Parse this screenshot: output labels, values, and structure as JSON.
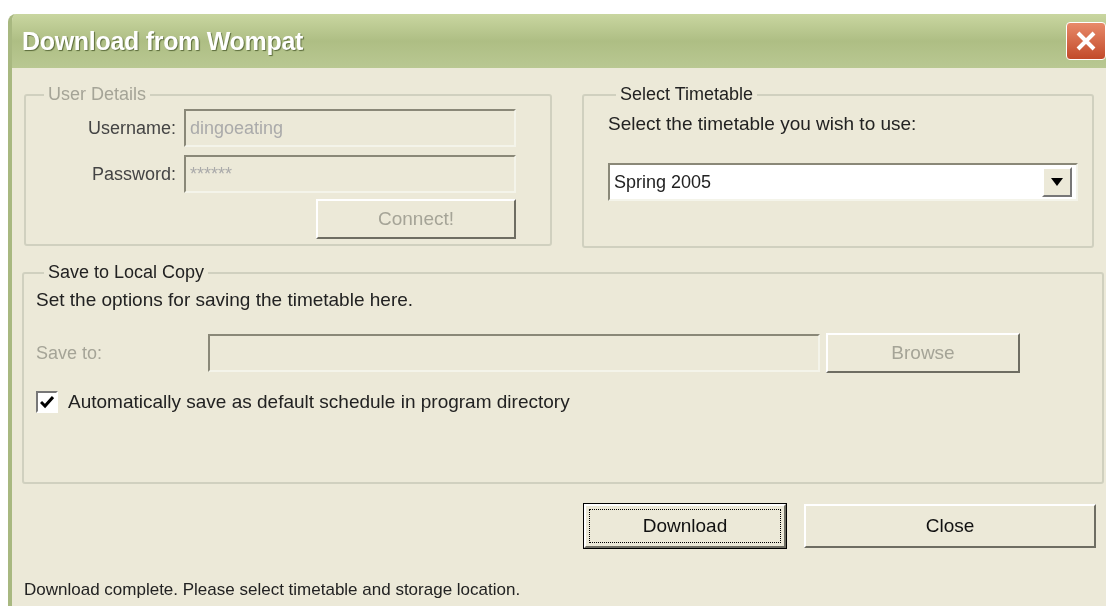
{
  "window": {
    "title": "Download from Wompat"
  },
  "user_details": {
    "legend": "User Details",
    "disabled": true,
    "fields": [
      {
        "label": "Username:",
        "value": "dingoeating"
      },
      {
        "label": "Password:",
        "value": "******"
      }
    ],
    "connect_button": {
      "label": "Connect!",
      "disabled": true
    }
  },
  "select_timetable": {
    "legend": "Select Timetable",
    "prompt": "Select the timetable you wish to use:",
    "value": "Spring 2005"
  },
  "save_local": {
    "legend": "Save to Local Copy",
    "description": "Set the options for saving the timetable here.",
    "save_to": {
      "label": "Save to:",
      "disabled": true
    },
    "browse_button": {
      "label": "Browse",
      "disabled": true
    },
    "auto_save": {
      "label": "Automatically save as default schedule in program directory",
      "checked": true
    }
  },
  "buttons": [
    {
      "label": "Download",
      "focused": true
    },
    {
      "label": "Close",
      "focused": false
    }
  ],
  "status_bar": "Download complete. Please select timetable and storage location."
}
